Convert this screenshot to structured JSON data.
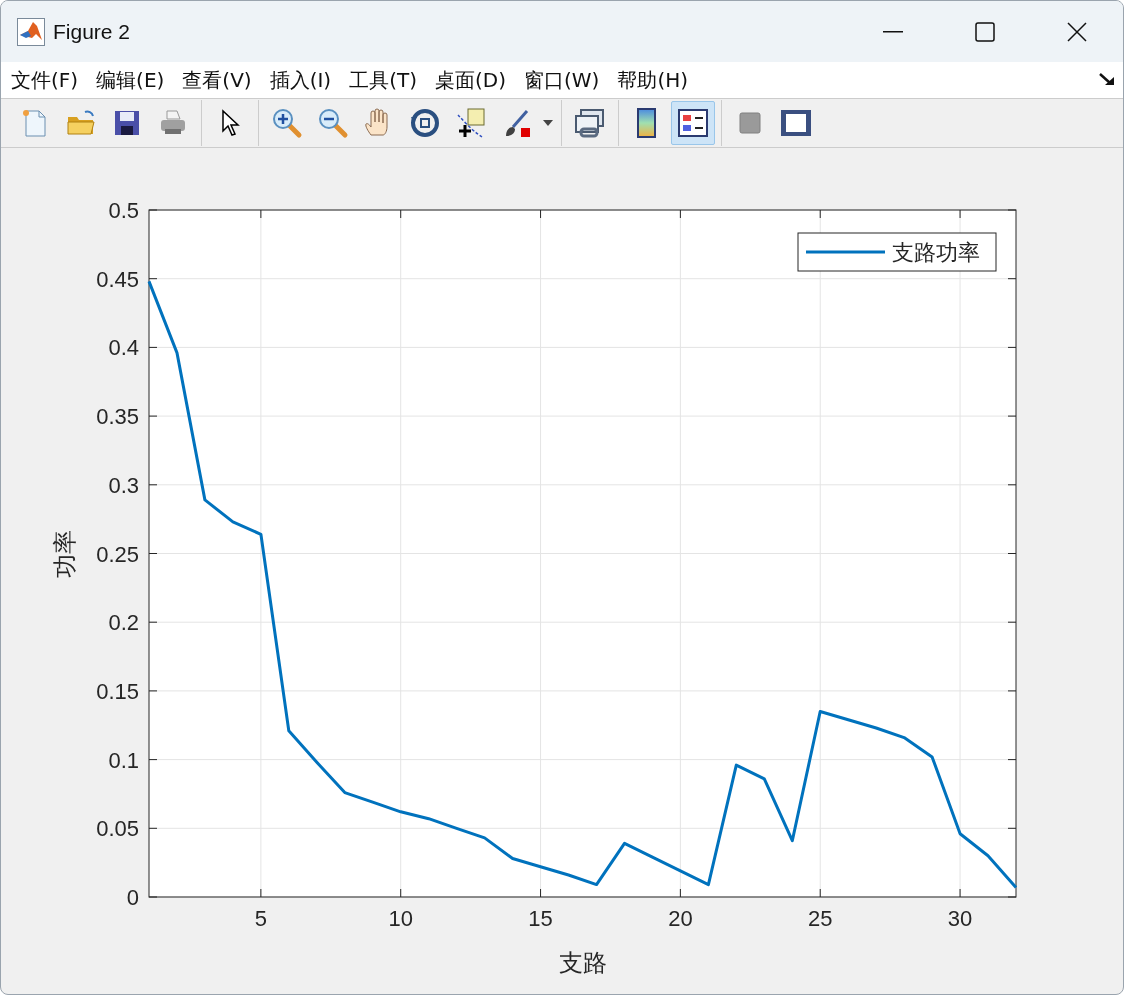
{
  "window": {
    "title": "Figure 2"
  },
  "menu": [
    {
      "label": "文件(F)"
    },
    {
      "label": "编辑(E)"
    },
    {
      "label": "查看(V)"
    },
    {
      "label": "插入(I)"
    },
    {
      "label": "工具(T)"
    },
    {
      "label": "桌面(D)"
    },
    {
      "label": "窗口(W)"
    },
    {
      "label": "帮助(H)"
    }
  ],
  "toolbar": [
    [
      {
        "kind": "new",
        "selected": false
      },
      {
        "kind": "open",
        "selected": false
      },
      {
        "kind": "save",
        "selected": false
      },
      {
        "kind": "print",
        "selected": false
      }
    ],
    [
      {
        "kind": "pointer",
        "selected": false
      }
    ],
    [
      {
        "kind": "zoom-in",
        "selected": false
      },
      {
        "kind": "zoom-out",
        "selected": false
      },
      {
        "kind": "pan",
        "selected": false
      },
      {
        "kind": "rotate",
        "selected": false
      },
      {
        "kind": "datatip",
        "selected": false
      },
      {
        "kind": "brush",
        "selected": false
      },
      {
        "kind": "dropdown",
        "selected": false
      }
    ],
    [
      {
        "kind": "link",
        "selected": false
      }
    ],
    [
      {
        "kind": "colorbar",
        "selected": false
      },
      {
        "kind": "legend",
        "selected": true
      }
    ],
    [
      {
        "kind": "hide",
        "selected": false
      },
      {
        "kind": "plottools",
        "selected": false
      }
    ]
  ],
  "figure": {
    "chart_data": {
      "type": "line",
      "grid": true,
      "xlabel": "支路",
      "ylabel": "功率",
      "xlim": [
        1,
        32
      ],
      "ylim": [
        0,
        0.5
      ],
      "xticks": [
        5,
        10,
        15,
        20,
        25,
        30
      ],
      "yticks": [
        0,
        0.05,
        0.1,
        0.15,
        0.2,
        0.25,
        0.3,
        0.35,
        0.4,
        0.45,
        0.5
      ],
      "x": [
        1,
        2,
        3,
        4,
        5,
        6,
        7,
        8,
        9,
        10,
        11,
        12,
        13,
        14,
        15,
        16,
        17,
        18,
        19,
        20,
        21,
        22,
        23,
        24,
        25,
        26,
        27,
        28,
        29,
        30,
        31,
        32
      ],
      "series": [
        {
          "name": "支路功率",
          "color": "#0072bd",
          "values": [
            0.448,
            0.396,
            0.289,
            0.273,
            0.264,
            0.121,
            0.098,
            0.076,
            0.069,
            0.062,
            0.057,
            0.05,
            0.043,
            0.028,
            0.022,
            0.016,
            0.009,
            0.039,
            0.029,
            0.019,
            0.009,
            0.096,
            0.086,
            0.041,
            0.135,
            0.129,
            0.123,
            0.116,
            0.102,
            0.046,
            0.03,
            0.007
          ]
        }
      ]
    }
  }
}
